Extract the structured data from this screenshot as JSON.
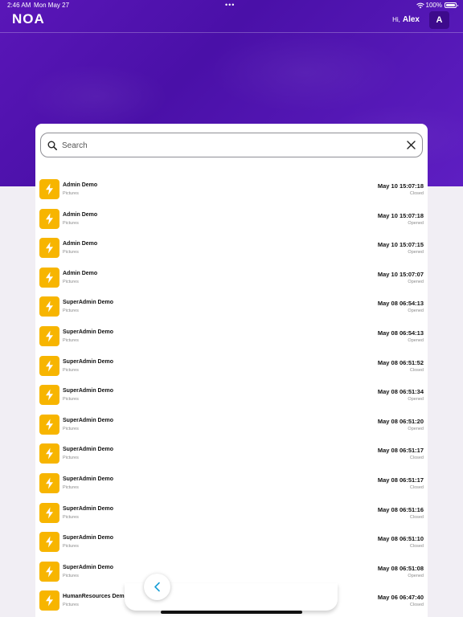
{
  "status_bar": {
    "time": "2:46 AM",
    "date": "Mon May 27",
    "dots": "•••",
    "battery": "100%"
  },
  "header": {
    "logo": "NOA",
    "greeting": "Hi,",
    "user_name": "Alex",
    "avatar_initial": "A"
  },
  "search": {
    "placeholder": "Search",
    "value": ""
  },
  "colors": {
    "brand_purple": "#5a16b8",
    "item_icon_yellow": "#f7b500",
    "back_arrow": "#1a9fd6"
  },
  "items": [
    {
      "title": "Admin Demo",
      "subtitle": "Pictures",
      "date": "May 10 15:07:18",
      "status": "Closed"
    },
    {
      "title": "Admin Demo",
      "subtitle": "Pictures",
      "date": "May 10 15:07:18",
      "status": "Opened"
    },
    {
      "title": "Admin Demo",
      "subtitle": "Pictures",
      "date": "May 10 15:07:15",
      "status": "Opened"
    },
    {
      "title": "Admin Demo",
      "subtitle": "Pictures",
      "date": "May 10 15:07:07",
      "status": "Opened"
    },
    {
      "title": "SuperAdmin Demo",
      "subtitle": "Pictures",
      "date": "May 08 06:54:13",
      "status": "Opened"
    },
    {
      "title": "SuperAdmin Demo",
      "subtitle": "Pictures",
      "date": "May 08 06:54:13",
      "status": "Opened"
    },
    {
      "title": "SuperAdmin Demo",
      "subtitle": "Pictures",
      "date": "May 08 06:51:52",
      "status": "Closed"
    },
    {
      "title": "SuperAdmin Demo",
      "subtitle": "Pictures",
      "date": "May 08 06:51:34",
      "status": "Opened"
    },
    {
      "title": "SuperAdmin Demo",
      "subtitle": "Pictures",
      "date": "May 08 06:51:20",
      "status": "Opened"
    },
    {
      "title": "SuperAdmin Demo",
      "subtitle": "Pictures",
      "date": "May 08 06:51:17",
      "status": "Closed"
    },
    {
      "title": "SuperAdmin Demo",
      "subtitle": "Pictures",
      "date": "May 08 06:51:17",
      "status": "Closed"
    },
    {
      "title": "SuperAdmin Demo",
      "subtitle": "Pictures",
      "date": "May 08 06:51:16",
      "status": "Closed"
    },
    {
      "title": "SuperAdmin Demo",
      "subtitle": "Pictures",
      "date": "May 08 06:51:10",
      "status": "Closed"
    },
    {
      "title": "SuperAdmin Demo",
      "subtitle": "Pictures",
      "date": "May 08 06:51:08",
      "status": "Opened"
    },
    {
      "title": "HumanResources Demo",
      "subtitle": "Pictures",
      "date": "May 06 06:47:40",
      "status": "Closed"
    }
  ],
  "icons": {
    "item_icon": "lightning-bolt-icon",
    "search_icon": "search-icon",
    "clear_icon": "close-icon",
    "back_icon": "chevron-left-icon"
  }
}
